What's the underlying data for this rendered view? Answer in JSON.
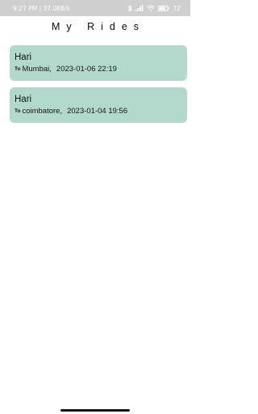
{
  "status_bar": {
    "time_speed": "9:27 PM | 37.0KB/s",
    "battery": "72"
  },
  "header": {
    "title": "My Rides"
  },
  "rides": [
    {
      "name": "Hari",
      "to_label": "To",
      "destination": "Mumbai,",
      "datetime": "2023-01-06 22:19"
    },
    {
      "name": "Hari",
      "to_label": "To",
      "destination": "coimbatore,",
      "datetime": "2023-01-04 19:56"
    }
  ],
  "colors": {
    "card_background": "#b3d9cc",
    "status_bar": "#cfcfcf"
  }
}
